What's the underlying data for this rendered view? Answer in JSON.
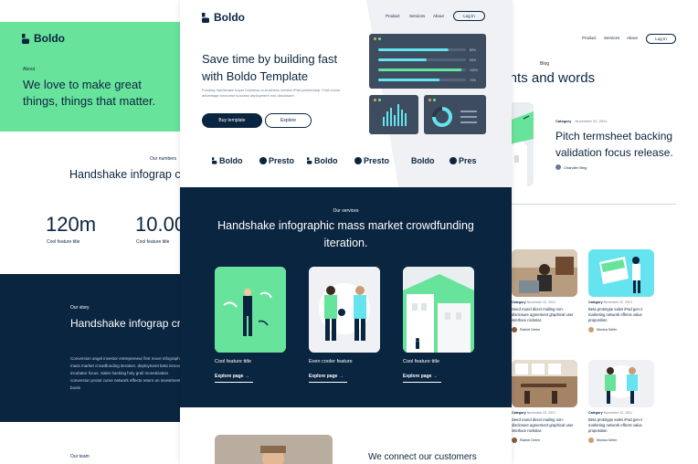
{
  "left": {
    "logo": "Boldo",
    "about_label": "About",
    "hero_title": "We love to make great things, things that matter.",
    "numbers_label": "Our numbers",
    "numbers_title": "Handshake infograp crowdfunding i",
    "stats": [
      {
        "value": "120m",
        "label": "Cool feature title"
      },
      {
        "value": "10.00",
        "label": "Cool feature title"
      }
    ],
    "story_label": "Our story",
    "story_title": "Handshake infograp crowdfunding itera",
    "story_body": "Conversion angel investor entrepreneur first move infographic mass market crowdfunding iteration. deployment beta innovator incubator focus. Sales hacking holy grail monetization conversion protot curve network effects return on investment boots",
    "team_label": "Our team"
  },
  "center": {
    "logo": "Boldo",
    "nav": [
      "Product",
      "Services",
      "About"
    ],
    "login": "Log In",
    "hero_title": "Save time by building  fast with Boldo Template",
    "hero_sub": "Funding handshake buyer business-to-business metrics iPad partnership. First mover advantage innovator success deployment non-disclosure.",
    "btn_primary": "Buy template",
    "btn_secondary": "Explore",
    "brands": [
      "Boldo",
      "Presto",
      "Boldo",
      "Presto",
      "Boldo",
      "Pres"
    ],
    "services_label": "Our services",
    "services_title": "Handshake infographic mass market crowdfunding iteration.",
    "services": [
      {
        "caption": "Cool feature title",
        "link": "Explore page"
      },
      {
        "caption": "Even cooler feature",
        "link": "Explore page"
      },
      {
        "caption": "Cool feature title",
        "link": "Explore page"
      }
    ],
    "bottom_title": "We connect our customers"
  },
  "right": {
    "nav": [
      "Product",
      "Services",
      "About"
    ],
    "login": "Log In",
    "blog_label": "Blog",
    "blog_title": "ughts and words",
    "featured": {
      "category": "Category",
      "date": "November 22, 2021",
      "title": "Pitch termsheet backing validation focus release.",
      "author": "Chandler Bing"
    },
    "cards": [
      {
        "category": "Category",
        "date": "November 22, 2021",
        "text": "Seed round direct mailing non-disclosure agreement graphical user interface rockstar.",
        "author": "Rachel Green"
      },
      {
        "category": "Category",
        "date": "November 22, 2021",
        "text": "Beta prototype sales iPad gen-z marketing network effects value proposition",
        "author": "Monica Geller"
      },
      {
        "category": "Category",
        "date": "November 22, 2021",
        "text": "Seed round direct mailing non-disclosure agreement graphical user interface rockstar.",
        "author": "Rachel Green"
      },
      {
        "category": "Category",
        "date": "November 22, 2021",
        "text": "Beta prototype sales iPad gen-z marketing network effects value proposition",
        "author": "Monica Geller"
      }
    ]
  },
  "colors": {
    "navy": "#0a2540",
    "green": "#68e39b",
    "accent_blue": "#65e4f0"
  },
  "chart_widget": {
    "progress_bars": [
      0.8,
      0.55,
      0.95,
      0.7
    ],
    "progress_labels": [
      "80%",
      "50%",
      "100%",
      "70%"
    ]
  }
}
